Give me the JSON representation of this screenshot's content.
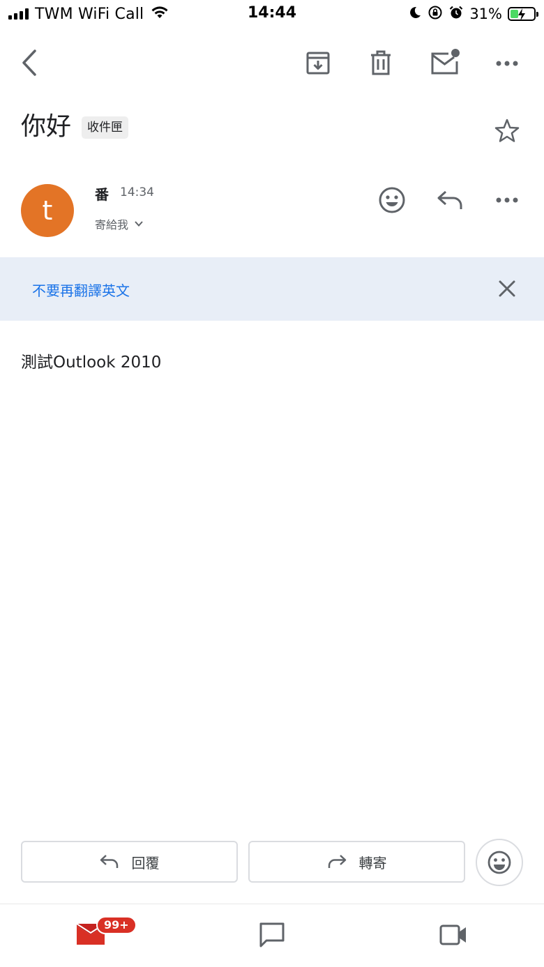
{
  "status_bar": {
    "carrier": "TWM WiFi Call",
    "time": "14:44",
    "battery": "31%"
  },
  "toolbar": {
    "icons": [
      "back-icon",
      "archive-icon",
      "delete-icon",
      "mark-unread-icon",
      "more-icon"
    ]
  },
  "email": {
    "subject": "你好",
    "label": "收件匣",
    "starred": false,
    "sender_initial": "t",
    "sender_name": "番",
    "time": "14:34",
    "recipient": "寄給我",
    "body": "測試Outlook 2010"
  },
  "translate_bar": {
    "link": "不要再翻譯英文"
  },
  "actions": {
    "reply": "回覆",
    "forward": "轉寄"
  },
  "bottom_nav": {
    "mail_badge": "99+"
  },
  "colors": {
    "avatar": "#e37426",
    "translate_bar_bg": "#e8eef7",
    "link": "#1a73e8",
    "mail_red": "#d93025"
  }
}
